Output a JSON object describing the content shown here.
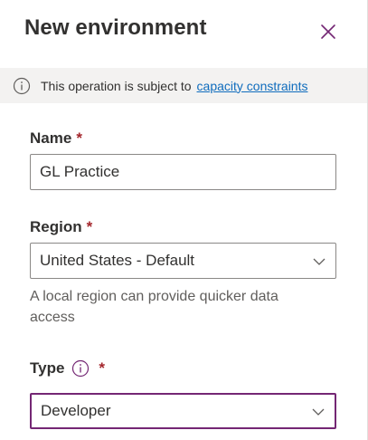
{
  "header": {
    "title": "New environment"
  },
  "notice": {
    "message": "This operation is subject to",
    "link_text": "capacity constraints"
  },
  "name_field": {
    "label": "Name",
    "required_mark": "*",
    "value": "GL Practice"
  },
  "region_field": {
    "label": "Region",
    "required_mark": "*",
    "selected": "United States - Default",
    "help_text": "A local region can provide quicker data access"
  },
  "type_field": {
    "label": "Type",
    "required_mark": "*",
    "selected": "Developer"
  },
  "icons": {
    "close": "close-icon",
    "info": "info-icon",
    "chevron": "chevron-down-icon"
  },
  "colors": {
    "accent": "#742774",
    "link": "#0f6cbd",
    "required": "#a4262c",
    "info_bar": "#f3f2f1"
  }
}
